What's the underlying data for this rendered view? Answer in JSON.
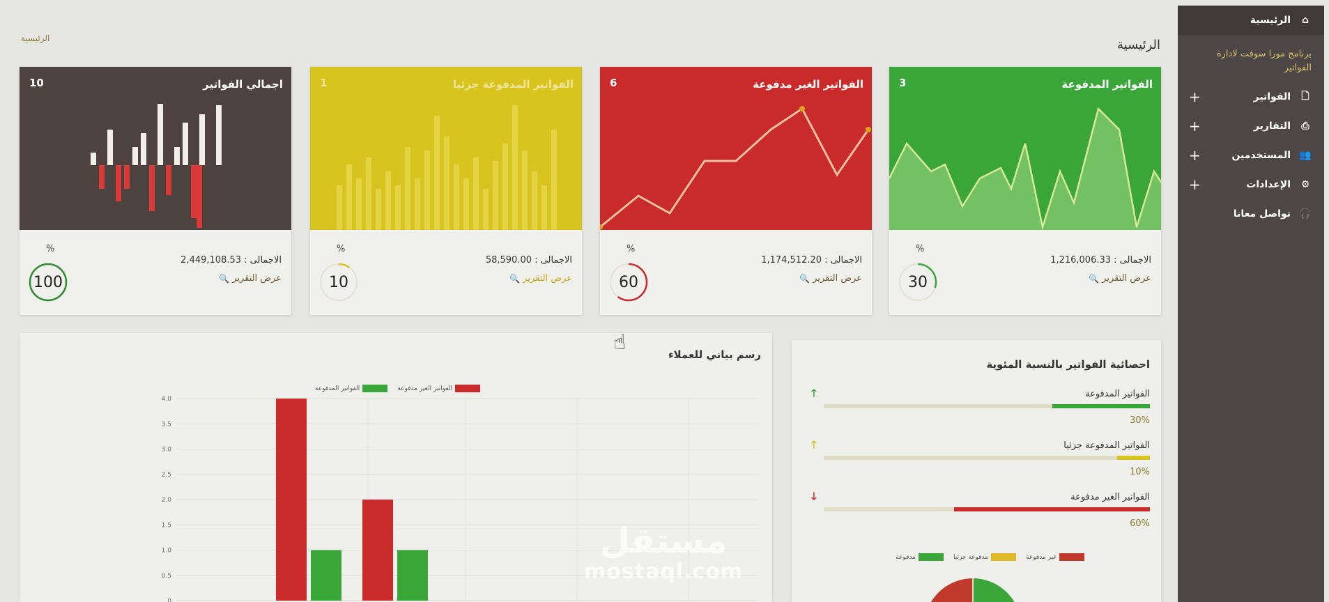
{
  "sidebar": {
    "items": [
      {
        "label": "الرئيسية",
        "icon": "home-icon",
        "active": true
      },
      {
        "label": "الفواتير",
        "icon": "file-icon"
      },
      {
        "label": "التقارير",
        "icon": "print-icon"
      },
      {
        "label": "المستخدمين",
        "icon": "users-icon"
      },
      {
        "label": "الإعدادات",
        "icon": "gear-icon"
      },
      {
        "label": "تواصل معانا",
        "icon": "headset-icon"
      }
    ],
    "description": "برنامج مورا سوفت لادارة الفواتير",
    "plus": "+"
  },
  "page": {
    "breadcrumb": "الرئيسية",
    "title": "الرئيسية"
  },
  "cards": [
    {
      "title": "الفواتير المدفوعة",
      "count": "3",
      "total": "الاجمالى : 1,216,006.33",
      "report": "عرض التقرير",
      "percent": 30,
      "color": "#3aa63a"
    },
    {
      "title": "الفواتير الغير مدفوعة",
      "count": "6",
      "total": "الاجمالى : 1,174,512.20",
      "report": "عرض التقرير",
      "percent": 60,
      "color": "#c92a2a"
    },
    {
      "title": "الفواتير المدفوعة جزئيا",
      "count": "1",
      "total": "الاجمالى : 58,590.00",
      "report": "عرض التقرير",
      "percent": 10,
      "color": "#d8c41e"
    },
    {
      "title": "اجمالي الفواتير",
      "count": "10",
      "total": "الاجمالى : 2,449,108.53",
      "report": "عرض التقرير",
      "percent": 100,
      "color": "#4d423e"
    }
  ],
  "percent_sign": "%",
  "stats_panel": {
    "title": "احصائية الفواتير بالنسبة المئوية",
    "rows": [
      {
        "label": "الفواتير المدفوعة",
        "value": "30%",
        "fraction": 0.3,
        "color": "#3aa63a",
        "arrow": "🡑",
        "arrow_color": "#3aa63a"
      },
      {
        "label": "الفواتير المدفوعة جزئيا",
        "value": "10%",
        "fraction": 0.1,
        "color": "#d8c41e",
        "arrow": "🡑",
        "arrow_color": "#d8c41e"
      },
      {
        "label": "الفواتير الغير مدفوعة",
        "value": "60%",
        "fraction": 0.6,
        "color": "#c92a2a",
        "arrow": "🡓",
        "arrow_color": "#c92a2a"
      }
    ],
    "legend": [
      {
        "label": "غير مدفوعة",
        "color": "#c0392b"
      },
      {
        "label": "مدفوعة جزئيا",
        "color": "#e0b92a"
      },
      {
        "label": "مدفوعة",
        "color": "#3aa63a"
      }
    ]
  },
  "chart_panel": {
    "title": "رسم بياني للعملاء"
  },
  "chart_data": {
    "type": "bar",
    "categories": [
      "",
      ""
    ],
    "series": [
      {
        "name": "الفواتير الغير مدفوعة",
        "values": [
          4,
          2
        ],
        "color": "#c92a2a"
      },
      {
        "name": "الفواتير المدفوعة",
        "values": [
          1,
          1
        ],
        "color": "#3aa63a"
      }
    ],
    "ylim": [
      0,
      4
    ],
    "yticks": [
      "0",
      "0.5",
      "1.0",
      "1.5",
      "2.0",
      "2.5",
      "3.0",
      "3.5",
      "4.0"
    ],
    "grid": true,
    "legend": "top"
  },
  "watermark": {
    "ar": "مستقل",
    "en": "mostaql.com"
  }
}
